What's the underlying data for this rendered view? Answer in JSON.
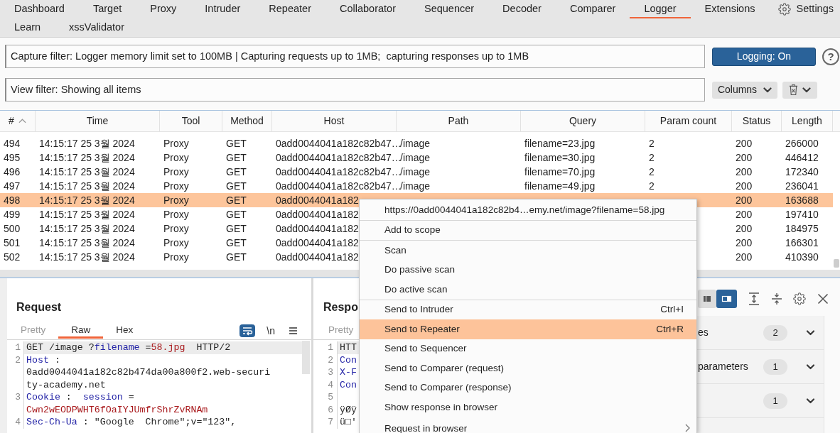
{
  "tab_rows": [
    {
      "tabs": [
        {
          "label": "Dashboard",
          "selected": false
        },
        {
          "label": "Target",
          "selected": false
        },
        {
          "label": "Proxy",
          "selected": false
        },
        {
          "label": "Intruder",
          "selected": false
        },
        {
          "label": "Repeater",
          "selected": false
        },
        {
          "label": "Collaborator",
          "selected": false
        },
        {
          "label": "Sequencer",
          "selected": false
        },
        {
          "label": "Decoder",
          "selected": false
        },
        {
          "label": "Comparer",
          "selected": false
        },
        {
          "label": "Logger",
          "selected": true
        },
        {
          "label": "Extensions",
          "selected": false
        }
      ]
    },
    {
      "tabs": [
        {
          "label": "Learn",
          "selected": false
        },
        {
          "label": "xssValidator",
          "selected": false
        }
      ]
    }
  ],
  "settings_button": {
    "label": "Settings"
  },
  "capture_filter": {
    "value": "Capture filter: Logger memory limit set to 100MB | Capturing requests up to 1MB;  capturing responses up to 1MB"
  },
  "logging_button": {
    "label": "Logging: On",
    "on": true
  },
  "help_button": {
    "label": "?"
  },
  "view_filter": {
    "value": "View filter: Showing all items"
  },
  "columns_button": {
    "label": "Columns"
  },
  "table": {
    "columns": [
      {
        "label": "#",
        "sort_ascending": true
      },
      {
        "label": "Time"
      },
      {
        "label": "Tool"
      },
      {
        "label": "Method"
      },
      {
        "label": "Host"
      },
      {
        "label": "Path"
      },
      {
        "label": "Query"
      },
      {
        "label": "Param count"
      },
      {
        "label": "Status"
      },
      {
        "label": "Length"
      }
    ],
    "rows": [
      {
        "number": "494",
        "time": "14:15:17 25 3월 2024",
        "tool": "Proxy",
        "method": "GET",
        "host": "0add0044041a182c82b47…",
        "path": "/image",
        "query": "filename=23.jpg",
        "param_count": "2",
        "status": "200",
        "length": "266000",
        "selected": false
      },
      {
        "number": "495",
        "time": "14:15:17 25 3월 2024",
        "tool": "Proxy",
        "method": "GET",
        "host": "0add0044041a182c82b47…",
        "path": "/image",
        "query": "filename=30.jpg",
        "param_count": "2",
        "status": "200",
        "length": "446412",
        "selected": false
      },
      {
        "number": "496",
        "time": "14:15:17 25 3월 2024",
        "tool": "Proxy",
        "method": "GET",
        "host": "0add0044041a182c82b47…",
        "path": "/image",
        "query": "filename=70.jpg",
        "param_count": "2",
        "status": "200",
        "length": "172340",
        "selected": false
      },
      {
        "number": "497",
        "time": "14:15:17 25 3월 2024",
        "tool": "Proxy",
        "method": "GET",
        "host": "0add0044041a182c82b47…",
        "path": "/image",
        "query": "filename=49.jpg",
        "param_count": "2",
        "status": "200",
        "length": "236041",
        "selected": false
      },
      {
        "number": "498",
        "time": "14:15:17 25 3월 2024",
        "tool": "Proxy",
        "method": "GET",
        "host": "0add0044041a182",
        "status": "200",
        "length": "163688",
        "selected": true
      },
      {
        "number": "499",
        "time": "14:15:17 25 3월 2024",
        "tool": "Proxy",
        "method": "GET",
        "host": "0add0044041a182",
        "status": "200",
        "length": "197410",
        "selected": false
      },
      {
        "number": "500",
        "time": "14:15:17 25 3월 2024",
        "tool": "Proxy",
        "method": "GET",
        "host": "0add0044041a182",
        "status": "200",
        "length": "184975",
        "selected": false
      },
      {
        "number": "501",
        "time": "14:15:17 25 3월 2024",
        "tool": "Proxy",
        "method": "GET",
        "host": "0add0044041a182",
        "status": "200",
        "length": "166301",
        "selected": false
      },
      {
        "number": "502",
        "time": "14:15:17 25 3월 2024",
        "tool": "Proxy",
        "method": "GET",
        "host": "0add0044041a182",
        "status": "200",
        "length": "410390",
        "selected": false
      }
    ]
  },
  "context_menu": {
    "groups": [
      {
        "items": [
          {
            "label": "https://0add0044041a182c82b4…emy.net/image?filename=58.jpg",
            "selected": false,
            "submenu": false
          }
        ]
      },
      {
        "items": [
          {
            "label": "Add to scope",
            "selected": false,
            "submenu": false
          }
        ]
      },
      {
        "items": [
          {
            "label": "Scan",
            "selected": false,
            "submenu": false
          },
          {
            "label": "Do passive scan",
            "selected": false,
            "submenu": false
          },
          {
            "label": "Do active scan",
            "selected": false,
            "submenu": false
          }
        ]
      },
      {
        "items": [
          {
            "label": "Send to Intruder",
            "shortcut": "Ctrl+I",
            "selected": false,
            "submenu": false
          },
          {
            "label": "Send to Repeater",
            "shortcut": "Ctrl+R",
            "selected": true,
            "submenu": false
          },
          {
            "label": "Send to Sequencer",
            "selected": false,
            "submenu": false
          },
          {
            "label": "Send to Comparer (request)",
            "selected": false,
            "submenu": false
          },
          {
            "label": "Send to Comparer (response)",
            "selected": false,
            "submenu": false
          },
          {
            "label": "Show response in browser",
            "selected": false,
            "submenu": false
          },
          {
            "label": "Request in browser",
            "selected": false,
            "submenu": true
          }
        ]
      }
    ]
  },
  "request_panel": {
    "title": "Request",
    "tabs": [
      {
        "label": "Pretty",
        "selected": false,
        "disabled": true
      },
      {
        "label": "Raw",
        "selected": true,
        "disabled": false
      },
      {
        "label": "Hex",
        "selected": false,
        "disabled": false
      }
    ],
    "wrap_button": {
      "on": true
    },
    "newline_button": {
      "label": "\\n"
    },
    "lines": [
      {
        "number": "1",
        "highlighted": true,
        "segments": [
          {
            "kind": "plain",
            "text": "GET /image ?"
          },
          {
            "kind": "name",
            "text": "filename"
          },
          {
            "kind": "plain",
            "text": " ="
          },
          {
            "kind": "value",
            "text": "58.jpg"
          },
          {
            "kind": "plain",
            "text": "  HTTP/2"
          }
        ]
      },
      {
        "number": "2",
        "highlighted": false,
        "segments": [
          {
            "kind": "name",
            "text": "Host"
          },
          {
            "kind": "plain",
            "text": " :"
          }
        ]
      },
      {
        "highlighted": false,
        "segments": [
          {
            "kind": "plain",
            "text": "0add0044041a182c82b474da00a800f2.web-securi"
          }
        ]
      },
      {
        "highlighted": false,
        "segments": [
          {
            "kind": "plain",
            "text": "ty-academy.net"
          }
        ]
      },
      {
        "number": "3",
        "highlighted": false,
        "segments": [
          {
            "kind": "name",
            "text": "Cookie"
          },
          {
            "kind": "plain",
            "text": " :  "
          },
          {
            "kind": "name",
            "text": "session"
          },
          {
            "kind": "plain",
            "text": " ="
          }
        ]
      },
      {
        "highlighted": false,
        "segments": [
          {
            "kind": "value",
            "text": "Cwn2wEODPWHT6fOaIYJUmfrShrZvRNAm"
          }
        ]
      },
      {
        "number": "4",
        "highlighted": false,
        "segments": [
          {
            "kind": "name",
            "text": "Sec-Ch-Ua"
          },
          {
            "kind": "plain",
            "text": " : \"Google  Chrome\";v=\"123\","
          }
        ]
      }
    ]
  },
  "response_panel": {
    "title": "Respo",
    "tabs": [
      {
        "label": "Pretty",
        "selected": false,
        "disabled": true
      }
    ],
    "lines": [
      {
        "number": "1",
        "highlighted": true,
        "segments": [
          {
            "kind": "plain",
            "text": "HTT"
          }
        ]
      },
      {
        "number": "2",
        "highlighted": false,
        "segments": [
          {
            "kind": "name",
            "text": "Con"
          }
        ]
      },
      {
        "number": "3",
        "highlighted": false,
        "segments": [
          {
            "kind": "name",
            "text": "X-F"
          }
        ]
      },
      {
        "number": "4",
        "highlighted": false,
        "segments": [
          {
            "kind": "name",
            "text": "Con"
          }
        ]
      },
      {
        "number": "5",
        "highlighted": false
      },
      {
        "number": "6",
        "highlighted": false,
        "segments": [
          {
            "kind": "plain",
            "text": "ÿØÿ"
          }
        ]
      },
      {
        "number": "7",
        "highlighted": false,
        "segments": [
          {
            "kind": "plain",
            "text": "ü□'"
          }
        ]
      }
    ]
  },
  "inspector": {
    "layout_options": [
      {
        "selected": false
      },
      {
        "selected": true
      }
    ],
    "sections": [
      {
        "title": "es",
        "count": "2",
        "expanded": false
      },
      {
        "title": "parameters",
        "count": "1",
        "expanded": false
      },
      {
        "count": "1",
        "expanded": false
      }
    ]
  }
}
